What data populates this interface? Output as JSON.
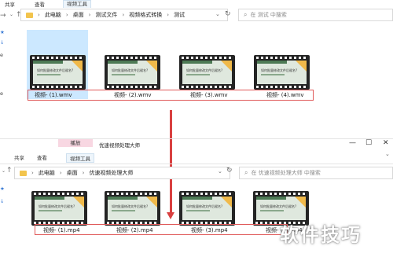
{
  "win1": {
    "ribbon_tabs": [
      "共享",
      "查看",
      "视频工具"
    ],
    "crumbs": [
      "此电脑",
      "桌面",
      "测试文件",
      "视频格式转换",
      "测试"
    ],
    "search_placeholder": "在 测试 中搜索",
    "side_labels": [
      "e",
      "e"
    ],
    "files": [
      "视频- (1).wmv",
      "视频- (2).wmv",
      "视频- (3).wmv",
      "视频- (4).wmv"
    ]
  },
  "win2": {
    "context_tab": "播放",
    "title": "优速视频处理大师",
    "ribbon_tabs": [
      "共享",
      "查看",
      "视频工具"
    ],
    "crumbs": [
      "此电脑",
      "桌面",
      "优速视频处理大师"
    ],
    "search_placeholder": "在 优速视频处理大师 中搜索",
    "files": [
      "视频- (1).mp4",
      "视频- (2).mp4",
      "视频- (3).mp4",
      "视频- (4).mp4"
    ]
  },
  "slide": {
    "title": "如何批量修改文件后缀名?"
  },
  "watermark": "软件技巧",
  "colors": {
    "accent_red": "#d94040",
    "selection": "#cce8ff",
    "context_pink": "#f8d7e2",
    "slide_green": "#4d7a55"
  }
}
